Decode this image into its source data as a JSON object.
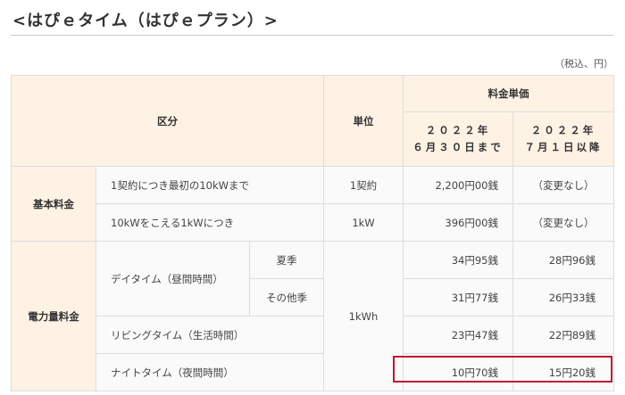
{
  "page": {
    "title": "<はぴｅタイム（はぴｅプラン）>",
    "tax_note": "（税込、円）"
  },
  "table": {
    "header": {
      "category": "区分",
      "unit": "単位",
      "rate_group": "料金単価",
      "period1_line1": "２０２２年",
      "period1_line2": "６月３０日まで",
      "period2_line1": "２０２２年",
      "period2_line2": "７月１日以降"
    },
    "basic": {
      "label": "基本料金",
      "rows": [
        {
          "item": "1契約につき最初の10kWまで",
          "unit": "1契約",
          "rate_old": "2,200円00銭",
          "rate_new": "（変更なし）"
        },
        {
          "item": "10kWをこえる1kWにつき",
          "unit": "1kW",
          "rate_old": "396円00銭",
          "rate_new": "（変更なし）"
        }
      ]
    },
    "energy": {
      "label": "電力量料金",
      "unit": "1kWh",
      "daytime": {
        "label": "デイタイム（昼間時間）",
        "summer": {
          "season": "夏季",
          "rate_old": "34円95銭",
          "rate_new": "28円96銭"
        },
        "other": {
          "season": "その他季",
          "rate_old": "31円77銭",
          "rate_new": "26円33銭"
        }
      },
      "living": {
        "label": "リビングタイム（生活時間）",
        "rate_old": "23円47銭",
        "rate_new": "22円89銭"
      },
      "night": {
        "label": "ナイトタイム（夜間時間）",
        "rate_old": "10円70銭",
        "rate_new": "15円20銭"
      }
    },
    "highlight_color": "#c01530",
    "header_bg": "#fdf2e4"
  }
}
